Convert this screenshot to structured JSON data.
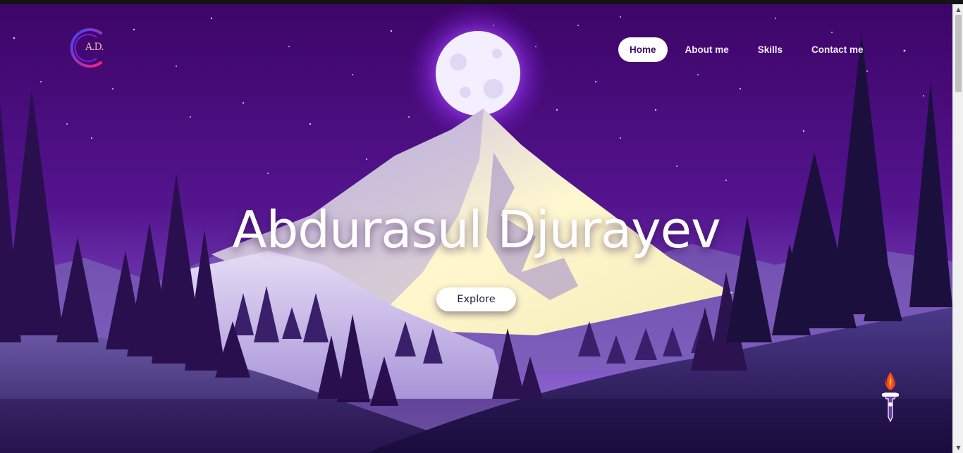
{
  "logo": {
    "text": "A.D.",
    "icon": "ad-monogram-logo"
  },
  "nav": {
    "items": [
      {
        "label": "Home",
        "active": true
      },
      {
        "label": "About me",
        "active": false
      },
      {
        "label": "Skills",
        "active": false
      },
      {
        "label": "Contact me",
        "active": false
      }
    ]
  },
  "hero": {
    "title": "Abdurasul Djurayev",
    "button_label": "Explore"
  },
  "scroll_top": {
    "icon": "rocket-icon"
  },
  "colors": {
    "sky_top": "#3f056b",
    "sky_bottom": "#7a45c0",
    "moon": "#f4f0ff",
    "moon_glow": "#a13cf0",
    "mountain_light": "#fbf6c4",
    "tree_dark": "#2a0f4f",
    "accent_white": "#ffffff"
  }
}
